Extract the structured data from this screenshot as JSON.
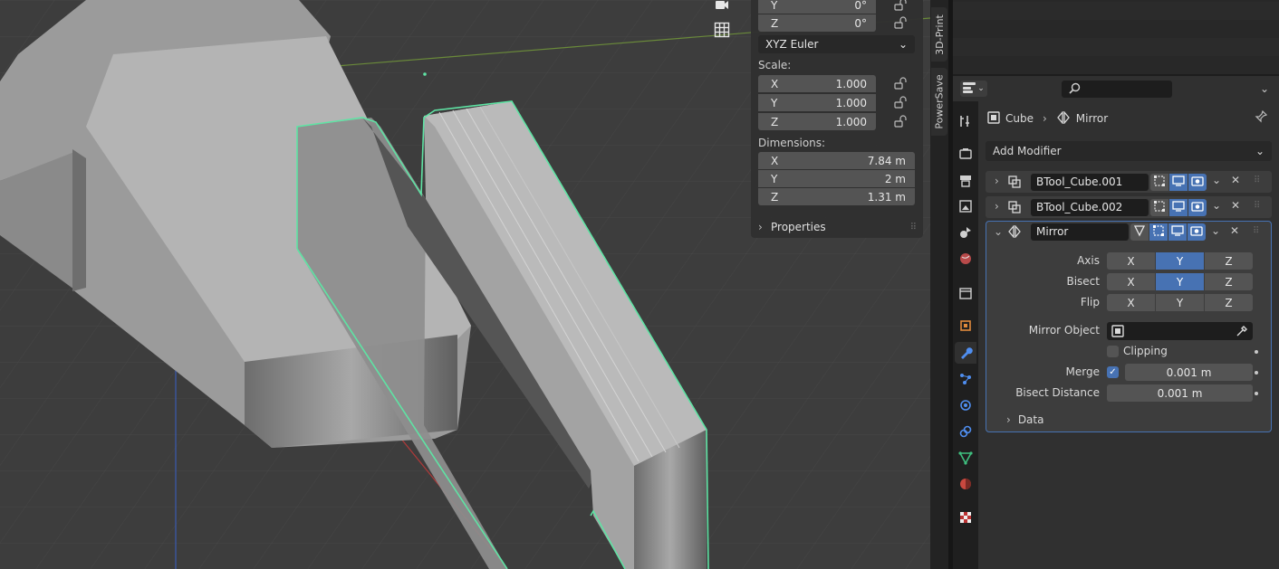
{
  "viewport": {
    "tools": [
      {
        "name": "camera-icon"
      },
      {
        "name": "grid-icon"
      }
    ]
  },
  "npanel": {
    "rotation_y_axis": "Y",
    "rotation_y_value": "0°",
    "rotation_z_axis": "Z",
    "rotation_z_value": "0°",
    "rotation_mode": "XYZ Euler",
    "scale_label": "Scale:",
    "scale": [
      {
        "axis": "X",
        "value": "1.000"
      },
      {
        "axis": "Y",
        "value": "1.000"
      },
      {
        "axis": "Z",
        "value": "1.000"
      }
    ],
    "dimensions_label": "Dimensions:",
    "dimensions": [
      {
        "axis": "X",
        "value": "7.84 m"
      },
      {
        "axis": "Y",
        "value": "2 m"
      },
      {
        "axis": "Z",
        "value": "1.31 m"
      }
    ],
    "properties_label": "Properties"
  },
  "side_tabs": [
    "3D-Print",
    "PowerSave"
  ],
  "properties": {
    "breadcrumb_object": "Cube",
    "breadcrumb_modifier": "Mirror",
    "add_modifier_label": "Add Modifier",
    "modifiers": [
      {
        "name": "BTool_Cube.001"
      },
      {
        "name": "BTool_Cube.002"
      },
      {
        "name": "Mirror"
      }
    ],
    "mirror": {
      "axis_label": "Axis",
      "bisect_label": "Bisect",
      "flip_label": "Flip",
      "x": "X",
      "y": "Y",
      "z": "Z",
      "mirror_object_label": "Mirror Object",
      "clipping_label": "Clipping",
      "merge_label": "Merge",
      "merge_value": "0.001 m",
      "bisect_distance_label": "Bisect Distance",
      "bisect_distance_value": "0.001 m",
      "data_label": "Data"
    }
  },
  "colors": {
    "accent": "#4772b3",
    "selection_outline": "#5fe3a4"
  }
}
